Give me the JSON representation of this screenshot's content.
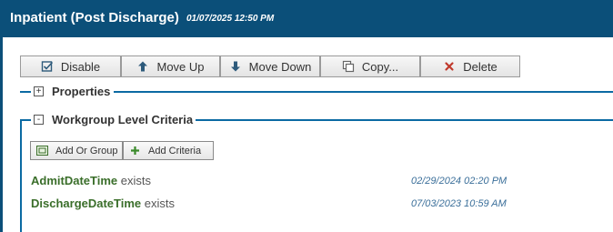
{
  "header": {
    "title": "Inpatient (Post Discharge)",
    "timestamp": "01/07/2025 12:50 PM"
  },
  "toolbar": {
    "disable": "Disable",
    "move_up": "Move Up",
    "move_down": "Move Down",
    "copy": "Copy...",
    "delete": "Delete"
  },
  "sections": {
    "properties": {
      "label": "Properties",
      "toggle": "+"
    },
    "criteria": {
      "label": "Workgroup Level Criteria",
      "toggle": "-"
    }
  },
  "criteria_actions": {
    "add_or_group": "Add Or Group",
    "add_criteria": "Add Criteria"
  },
  "criteria_rows": [
    {
      "field": "AdmitDateTime",
      "operator": "exists",
      "date": "02/29/2024 02:20 PM"
    },
    {
      "field": "DischargeDateTime",
      "operator": "exists",
      "date": "07/03/2023 10:59 AM"
    }
  ],
  "colors": {
    "header_bg": "#0b4f79",
    "section_line": "#0b6aa3",
    "field_text": "#3a6e2a",
    "date_text": "#3b6f9a",
    "delete_icon": "#c0392b"
  }
}
